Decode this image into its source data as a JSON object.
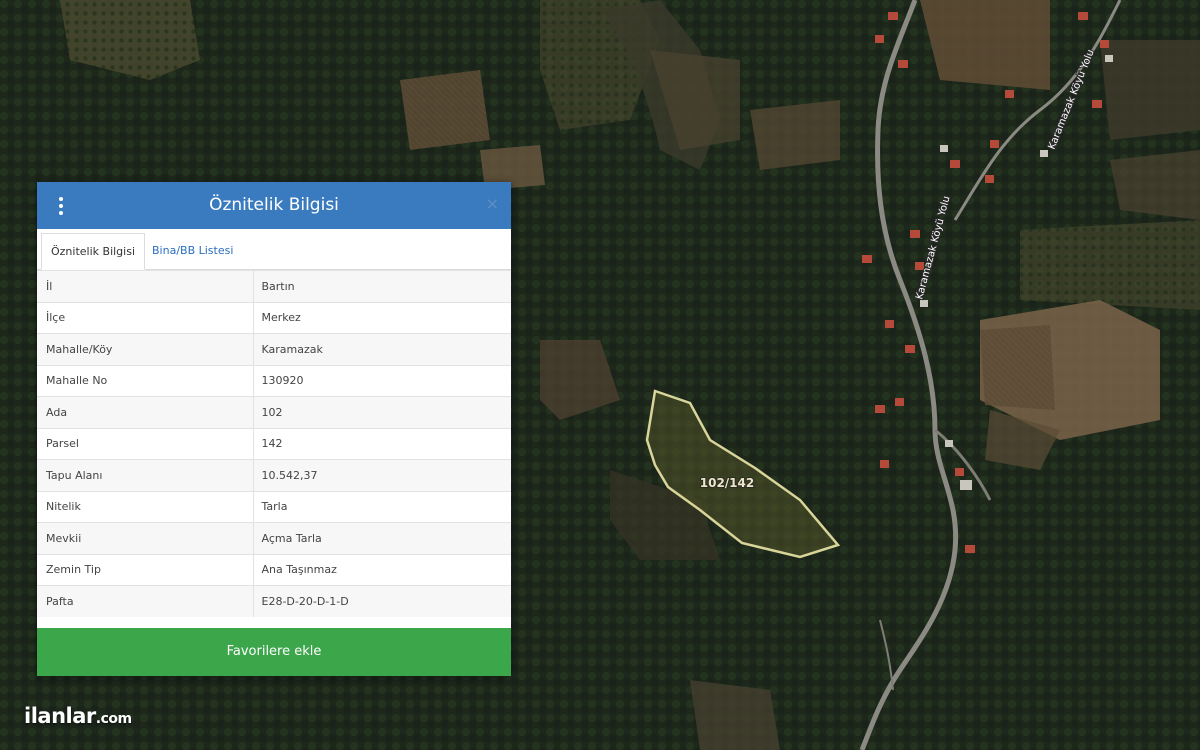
{
  "map": {
    "parcel_label": "102/142",
    "road_labels": [
      "Karamazak Köyü Yolu",
      "Karamazak Köyü Yolu"
    ],
    "parcel_stroke": "#d9d59a",
    "parcel_fill": "rgba(80,82,40,0.55)",
    "road_color": "#8a8a82"
  },
  "panel": {
    "title": "Öznitelik Bilgisi",
    "close_glyph": "×",
    "tabs": [
      {
        "label": "Öznitelik Bilgisi",
        "active": true
      },
      {
        "label": "Bina/BB Listesi",
        "active": false
      }
    ],
    "rows": [
      {
        "key": "İl",
        "value": "Bartın"
      },
      {
        "key": "İlçe",
        "value": "Merkez"
      },
      {
        "key": "Mahalle/Köy",
        "value": "Karamazak"
      },
      {
        "key": "Mahalle No",
        "value": "130920"
      },
      {
        "key": "Ada",
        "value": "102"
      },
      {
        "key": "Parsel",
        "value": "142"
      },
      {
        "key": "Tapu Alanı",
        "value": "10.542,37"
      },
      {
        "key": "Nitelik",
        "value": "Tarla"
      },
      {
        "key": "Mevkii",
        "value": "Açma Tarla"
      },
      {
        "key": "Zemin Tip",
        "value": "Ana Taşınmaz"
      },
      {
        "key": "Pafta",
        "value": "E28-D-20-D-1-D"
      }
    ],
    "favorite_button": "Favorilere ekle",
    "header_color": "#3a7bbf",
    "button_color": "#3ba64a"
  },
  "watermark": {
    "main": "ilanlar",
    "suffix": ".com",
    "logo": "ilanlar.com"
  }
}
